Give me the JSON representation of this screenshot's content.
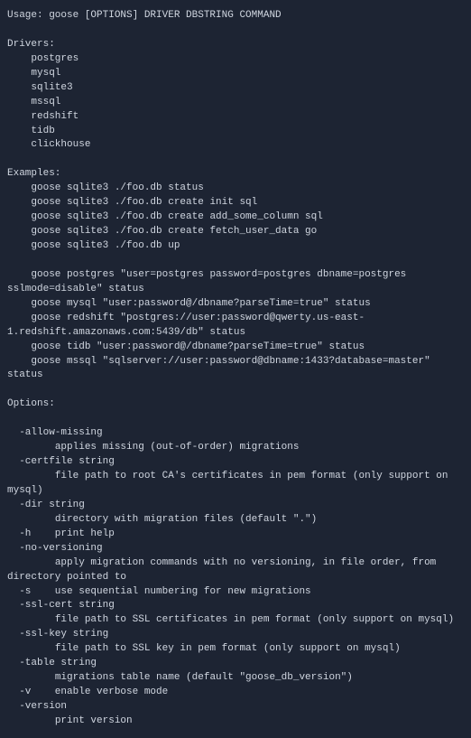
{
  "usage_line": "Usage: goose [OPTIONS] DRIVER DBSTRING COMMAND",
  "drivers_header": "Drivers:",
  "drivers": [
    "postgres",
    "mysql",
    "sqlite3",
    "mssql",
    "redshift",
    "tidb",
    "clickhouse"
  ],
  "examples_header": "Examples:",
  "examples": [
    "goose sqlite3 ./foo.db status",
    "goose sqlite3 ./foo.db create init sql",
    "goose sqlite3 ./foo.db create add_some_column sql",
    "goose sqlite3 ./foo.db create fetch_user_data go",
    "goose sqlite3 ./foo.db up",
    "",
    "goose postgres \"user=postgres password=postgres dbname=postgres sslmode=disable\" status",
    "goose mysql \"user:password@/dbname?parseTime=true\" status",
    "goose redshift \"postgres://user:password@qwerty.us-east-1.redshift.amazonaws.com:5439/db\" status",
    "goose tidb \"user:password@/dbname?parseTime=true\" status",
    "goose mssql \"sqlserver://user:password@dbname:1433?database=master\" status"
  ],
  "options_header": "Options:",
  "options": [
    {
      "flag": "-allow-missing",
      "desc": "applies missing (out-of-order) migrations",
      "inline": false
    },
    {
      "flag": "-certfile string",
      "desc": "file path to root CA's certificates in pem format (only support on mysql)",
      "inline": false
    },
    {
      "flag": "-dir string",
      "desc": "directory with migration files (default \".\")",
      "inline": false
    },
    {
      "flag": "-h",
      "desc": "print help",
      "inline": true
    },
    {
      "flag": "-no-versioning",
      "desc": "apply migration commands with no versioning, in file order, from directory pointed to",
      "inline": false
    },
    {
      "flag": "-s",
      "desc": "use sequential numbering for new migrations",
      "inline": true
    },
    {
      "flag": "-ssl-cert string",
      "desc": "file path to SSL certificates in pem format (only support on mysql)",
      "inline": false
    },
    {
      "flag": "-ssl-key string",
      "desc": "file path to SSL key in pem format (only support on mysql)",
      "inline": false
    },
    {
      "flag": "-table string",
      "desc": "migrations table name (default \"goose_db_version\")",
      "inline": false
    },
    {
      "flag": "-v",
      "desc": "enable verbose mode",
      "inline": true
    },
    {
      "flag": "-version",
      "desc": "print version",
      "inline": false
    }
  ]
}
